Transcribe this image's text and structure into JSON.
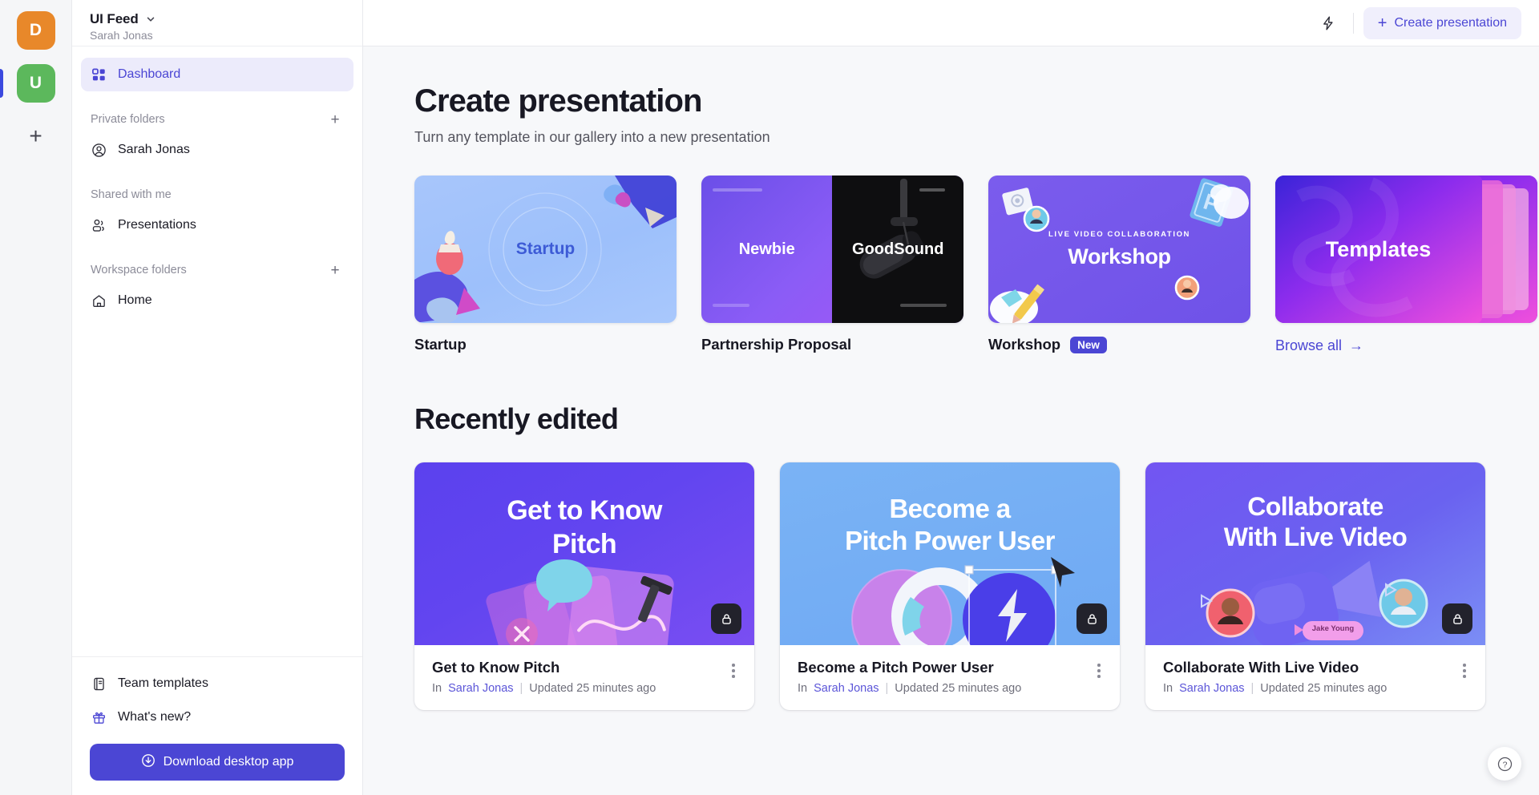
{
  "rail": {
    "avatars": [
      {
        "letter": "D",
        "color": "#e8882a",
        "active": false
      },
      {
        "letter": "U",
        "color": "#5cb85c",
        "active": true
      }
    ],
    "add_label": "+"
  },
  "sidebar": {
    "workspace_title": "UI Feed",
    "workspace_owner": "Sarah Jonas",
    "dashboard_label": "Dashboard",
    "sections": [
      {
        "title": "Private folders",
        "add": "+",
        "items": [
          {
            "label": "Sarah Jonas",
            "icon": "user-circle-icon"
          }
        ]
      },
      {
        "title": "Shared with me",
        "add": "",
        "items": [
          {
            "label": "Presentations",
            "icon": "people-icon"
          }
        ]
      },
      {
        "title": "Workspace folders",
        "add": "+",
        "items": [
          {
            "label": "Home",
            "icon": "home-icon"
          }
        ]
      }
    ],
    "footer_items": [
      {
        "label": "Team templates",
        "icon": "book-icon"
      },
      {
        "label": "What's new?",
        "icon": "gift-icon"
      }
    ],
    "download_label": "Download desktop app"
  },
  "topbar": {
    "lightning_icon": "lightning-icon",
    "create_label": "Create presentation",
    "create_plus": "+"
  },
  "main": {
    "title": "Create presentation",
    "subtitle": "Turn any template in our gallery into a new presentation",
    "templates": [
      {
        "name": "Startup",
        "badge": "",
        "art_title": "Startup",
        "art_eyebrow": ""
      },
      {
        "name": "Partnership Proposal",
        "badge": "",
        "art_title": "Newbie",
        "art_title2": "GoodSound",
        "art_eyebrow": ""
      },
      {
        "name": "Workshop",
        "badge": "New",
        "art_title": "Workshop",
        "art_eyebrow": "LIVE VIDEO COLLABORATION"
      },
      {
        "name": "",
        "badge": "",
        "art_title": "Templates",
        "browse_label": "Browse all",
        "browse_arrow": "→"
      }
    ],
    "recent_title": "Recently edited",
    "presentations": [
      {
        "title": "Get to Know Pitch",
        "art_line1": "Get to Know",
        "art_line2": "Pitch",
        "in_label": "In",
        "owner": "Sarah Jonas",
        "divider": "|",
        "updated": "Updated 25 minutes ago",
        "locked": true
      },
      {
        "title": "Become a Pitch Power User",
        "art_line1": "Become a",
        "art_line2": "Pitch Power User",
        "in_label": "In",
        "owner": "Sarah Jonas",
        "divider": "|",
        "updated": "Updated 25 minutes ago",
        "locked": true
      },
      {
        "title": "Collaborate With Live Video",
        "art_line1": "Collaborate",
        "art_line2": "With Live Video",
        "art_nametag": "Jake Young",
        "in_label": "In",
        "owner": "Sarah Jonas",
        "divider": "|",
        "updated": "Updated 25 minutes ago",
        "locked": true
      }
    ],
    "help_label": "?"
  },
  "colors": {
    "accent": "#4b46d4",
    "accent_soft": "#ecebfb",
    "canvas": "#f7f8fa"
  }
}
